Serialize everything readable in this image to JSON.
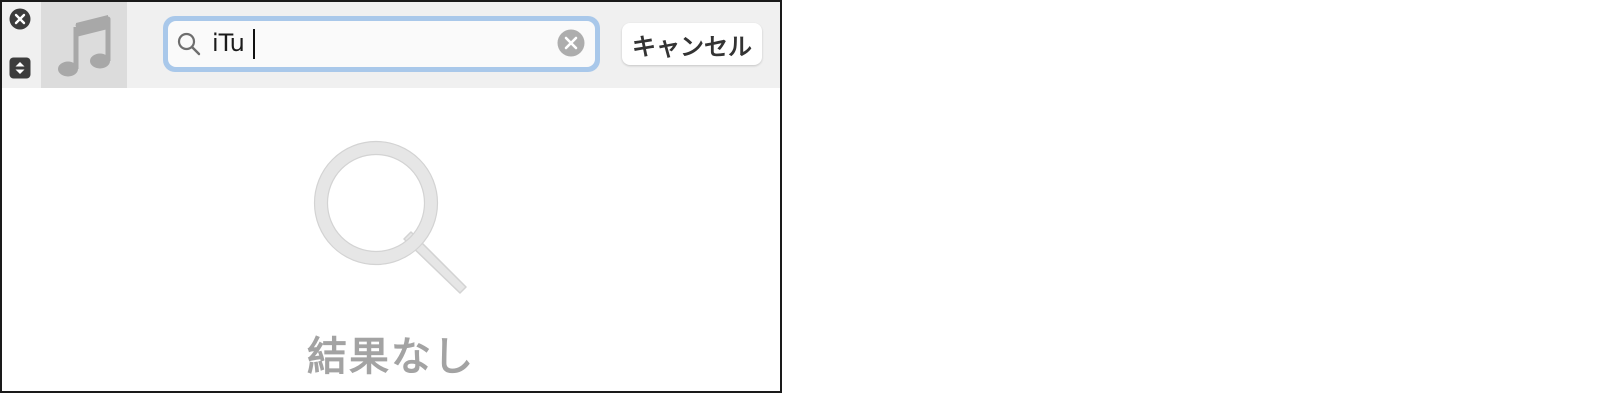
{
  "window": {
    "close_icon": "close-icon",
    "resize_icon": "resize-stepper-icon",
    "artwork_icon": "music-note-icon"
  },
  "search": {
    "value": "iTu",
    "placeholder": "",
    "icon": "search-icon",
    "clear_icon": "clear-circle-icon",
    "focus_color": "#a9c8ea"
  },
  "toolbar": {
    "cancel_label": "キャンセル"
  },
  "empty_state": {
    "icon": "magnifier-icon",
    "message": "結果なし"
  }
}
